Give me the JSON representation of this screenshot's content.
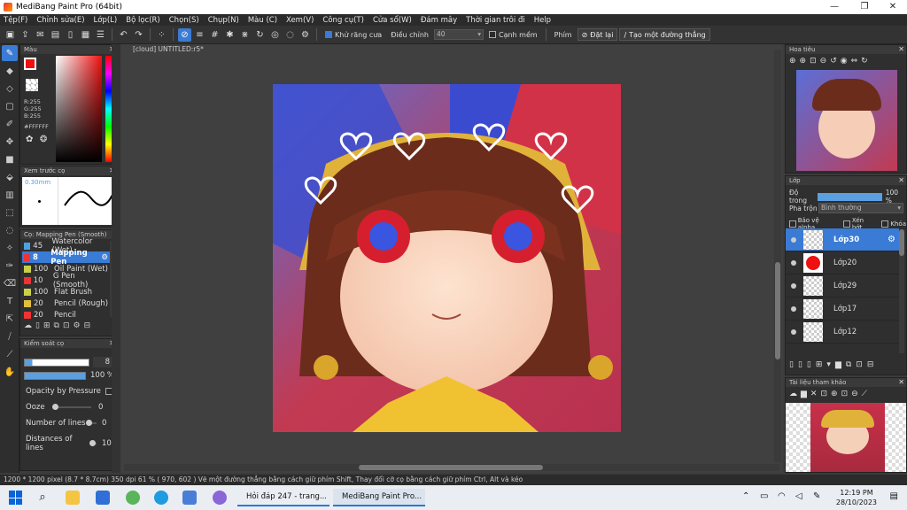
{
  "window": {
    "title": "MediBang Paint Pro (64bit)",
    "controls": [
      "—",
      "❐",
      "✕"
    ]
  },
  "menu": [
    "Tệp(F)",
    "Chỉnh sửa(E)",
    "Lớp(L)",
    "Bộ lọc(R)",
    "Chọn(S)",
    "Chụp(N)",
    "Màu (C)",
    "Xem(V)",
    "Công cụ(T)",
    "Cửa sổ(W)",
    "Đám mây",
    "Thời gian trôi đi",
    "Help"
  ],
  "toolbar": {
    "antialias_label": "Khử răng cưa",
    "adjust_label": "Điều chỉnh",
    "adjust_value": "40",
    "edge_label": "Cạnh mềm",
    "key_label": "Phím",
    "reset_label": "Đặt lại",
    "line_label": "Tạo một đường thẳng"
  },
  "color_panel": {
    "title": "Màu",
    "r": "R:255",
    "g": "G:255",
    "b": "B:255",
    "hex": "#FFFFFF",
    "foreground": "#e11a1a",
    "background": "#ffffff"
  },
  "brush_preview": {
    "title": "Xem trước cọ",
    "size": "0.30mm"
  },
  "brush_list": {
    "title": "Cọ: Mapping Pen (Smooth)",
    "items": [
      {
        "size": "45",
        "name": "Watercolor (Wet)",
        "color": "#4aa3e0"
      },
      {
        "size": "8",
        "name": "Mapping Pen",
        "color": "#e33"
      },
      {
        "size": "100",
        "name": "Oil Paint (Wet)",
        "color": "#c8d04a"
      },
      {
        "size": "10",
        "name": "G Pen (Smooth)",
        "color": "#e33"
      },
      {
        "size": "100",
        "name": "Flat Brush",
        "color": "#c8d04a"
      },
      {
        "size": "20",
        "name": "Pencil (Rough)",
        "color": "#e0c040"
      },
      {
        "size": "20",
        "name": "Pencil",
        "color": "#e33"
      }
    ]
  },
  "brush_control": {
    "title": "Kiểm soát cọ",
    "size_value": "8",
    "opacity_value": "100 %",
    "opacity_fraction": 1.0,
    "opacity_by_pressure": "Opacity by Pressure",
    "ooze_label": "Ooze",
    "ooze_value": "0",
    "lines_label": "Number of lines",
    "lines_value": "0",
    "distance_label": "Distances of lines",
    "distance_value": "10"
  },
  "document": {
    "tab": "[cloud] UNTITLED:r5*"
  },
  "navigator": {
    "title": "Hoa tiêu"
  },
  "layers": {
    "title": "Lớp",
    "opacity_label": "Độ trong",
    "opacity_value": "100 %",
    "blend_label": "Pha trộn",
    "blend_value": "Bình thường",
    "protect_alpha": "Bảo vệ alpha",
    "clip": "Xén bớt",
    "lock": "Khóa",
    "items": [
      {
        "name": "Lớp30",
        "selected": true
      },
      {
        "name": "Lớp20",
        "selected": false
      },
      {
        "name": "Lớp29",
        "selected": false
      },
      {
        "name": "Lớp17",
        "selected": false
      },
      {
        "name": "Lớp12",
        "selected": false
      }
    ]
  },
  "reference": {
    "title": "Tài liệu tham khảo"
  },
  "status": "1200 * 1200 pixel   (8.7 * 8.7cm)   350 dpi   61 %   ( 970, 602 )   Vẽ một đường thẳng bằng cách giữ phím Shift, Thay đổi cỡ cọ bằng cách giữ phím Ctrl, Alt và kéo",
  "taskbar": {
    "app1": "Hỏi đáp 247 - trang...",
    "app2": "MediBang Paint Pro...",
    "time": "12:19 PM",
    "date": "28/10/2023"
  }
}
